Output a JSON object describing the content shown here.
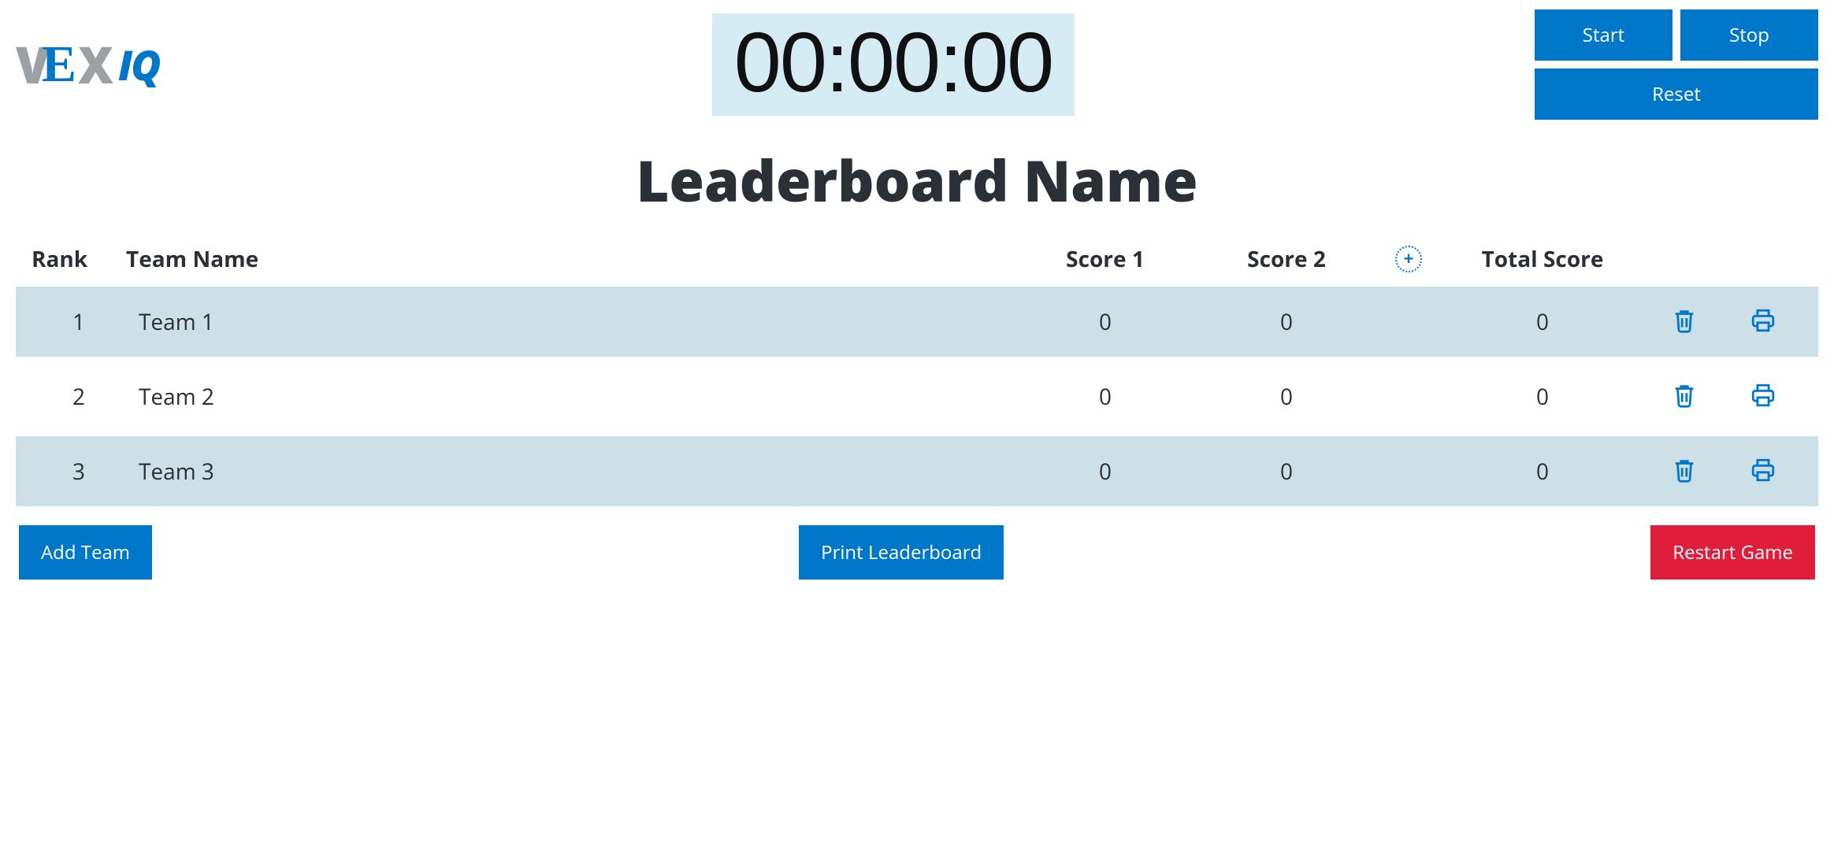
{
  "timer": {
    "display": "00:00:00",
    "start_label": "Start",
    "stop_label": "Stop",
    "reset_label": "Reset"
  },
  "title": "Leaderboard Name",
  "headers": {
    "rank": "Rank",
    "team_name": "Team Name",
    "score1": "Score 1",
    "score2": "Score 2",
    "total": "Total Score",
    "add_column_icon": "plus-icon"
  },
  "rows": [
    {
      "rank": "1",
      "name": "Team 1",
      "score1": "0",
      "score2": "0",
      "total": "0"
    },
    {
      "rank": "2",
      "name": "Team 2",
      "score1": "0",
      "score2": "0",
      "total": "0"
    },
    {
      "rank": "3",
      "name": "Team 3",
      "score1": "0",
      "score2": "0",
      "total": "0"
    }
  ],
  "footer": {
    "add_team": "Add Team",
    "print": "Print Leaderboard",
    "restart": "Restart Game"
  },
  "colors": {
    "blue": "#0077C8",
    "red": "#E01E3C",
    "timer_bg": "#D6ECF5",
    "row_alt": "#CDE0E8"
  }
}
